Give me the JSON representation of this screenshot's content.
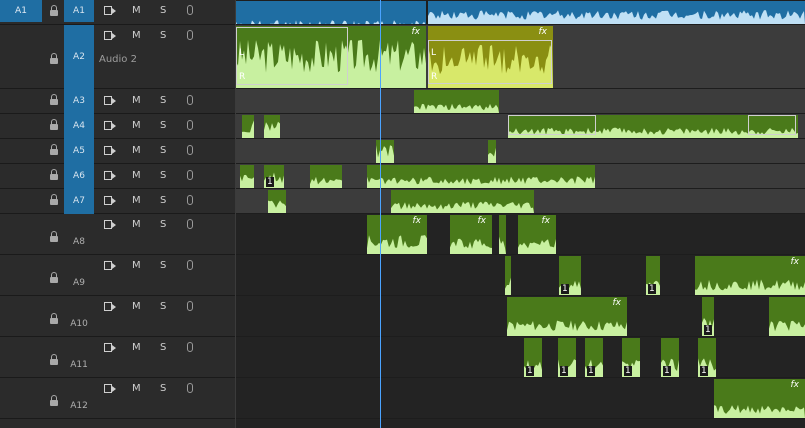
{
  "master": {
    "patch_label": "A1",
    "target_label": "A1"
  },
  "tracks": [
    {
      "id": "A2",
      "name": "Audio 2",
      "targeted": true
    },
    {
      "id": "A3",
      "targeted": true
    },
    {
      "id": "A4",
      "targeted": true
    },
    {
      "id": "A5",
      "targeted": true
    },
    {
      "id": "A6",
      "targeted": true
    },
    {
      "id": "A7",
      "targeted": true
    },
    {
      "id": "A8",
      "targeted": false
    },
    {
      "id": "A9",
      "targeted": false
    },
    {
      "id": "A10",
      "targeted": false
    },
    {
      "id": "A11",
      "targeted": false
    },
    {
      "id": "A12",
      "targeted": false
    }
  ],
  "buttons": {
    "mute": "M",
    "solo": "S"
  },
  "clip_badges": {
    "fx": "fx",
    "one": "1",
    "left_channel": "L",
    "right_channel": "R"
  },
  "colors": {
    "target_blue": "#1f6ea3",
    "clip_green": "#4a7a1a",
    "clip_yellow": "#8a8f12",
    "waveform": "#c8f0a0",
    "playhead": "#4aa3ff"
  }
}
